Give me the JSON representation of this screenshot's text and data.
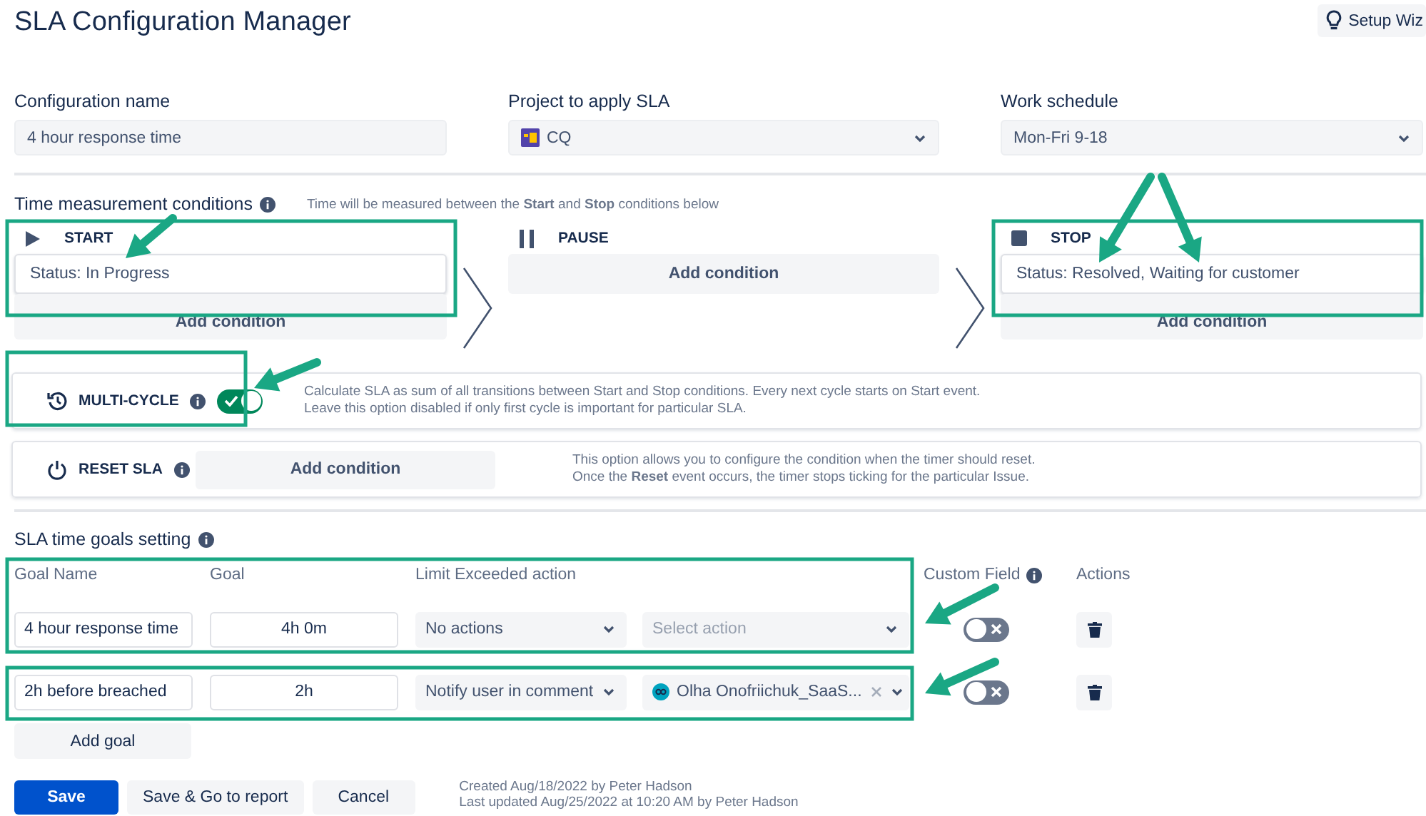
{
  "title": "SLA Configuration Manager",
  "setup_button": "Setup Wiz",
  "fields": [
    {
      "label": "Configuration name",
      "kind": "text",
      "value": "4 hour response time"
    },
    {
      "label": "Project to apply SLA",
      "kind": "project",
      "value": "CQ"
    },
    {
      "label": "Work schedule",
      "kind": "select",
      "value": "Mon-Fri 9-18"
    }
  ],
  "time_conditions": {
    "title": "Time measurement conditions",
    "hint": "Time will be measured between the **Start** and **Stop** conditions below",
    "columns": [
      {
        "kind": "start",
        "label": "START",
        "conditions": [
          "Status: In Progress"
        ],
        "add_button": "Add condition"
      },
      {
        "kind": "pause",
        "label": "PAUSE",
        "add_button": "Add condition"
      },
      {
        "kind": "stop",
        "label": "STOP",
        "conditions": [
          "Status: Resolved, Waiting for customer"
        ],
        "add_button": "Add condition"
      }
    ]
  },
  "multi_cycle": {
    "label": "MULTI-CYCLE",
    "on": true,
    "description": [
      "Calculate SLA as sum of all transitions between Start and Stop conditions. Every next cycle starts on Start event.",
      "Leave this option disabled if only first cycle is important for particular SLA."
    ]
  },
  "reset": {
    "label": "RESET SLA",
    "button": "Add condition",
    "description": [
      "This option allows you to configure the condition when the timer should reset.",
      "Once the **Reset** event occurs, the timer stops ticking for the particular Issue."
    ]
  },
  "goals": {
    "title": "SLA time goals setting",
    "columns": [
      "Goal Name",
      "Goal",
      "Limit Exceeded action",
      "Custom Field",
      "Actions"
    ],
    "rows": [
      {
        "name": "4 hour response time",
        "goal": "4h 0m",
        "action": "No actions",
        "target": {
          "kind": "placeholder",
          "text": "Select action"
        },
        "custom_field": false
      },
      {
        "name": "2h before breached",
        "goal": "2h",
        "action": "Notify user in comment",
        "target": {
          "kind": "user",
          "text": "Olha Onofriichuk_SaaS..."
        },
        "custom_field": false
      }
    ],
    "add_button": "Add goal"
  },
  "footer": {
    "buttons": [
      {
        "label": "Save",
        "primary": true
      },
      {
        "label": "Save & Go to report",
        "primary": false
      },
      {
        "label": "Cancel",
        "primary": false
      }
    ],
    "notes": [
      "Created Aug/18/2022 by Peter Hadson",
      "Last updated Aug/25/2022 at 10:20 AM by Peter Hadson"
    ]
  }
}
